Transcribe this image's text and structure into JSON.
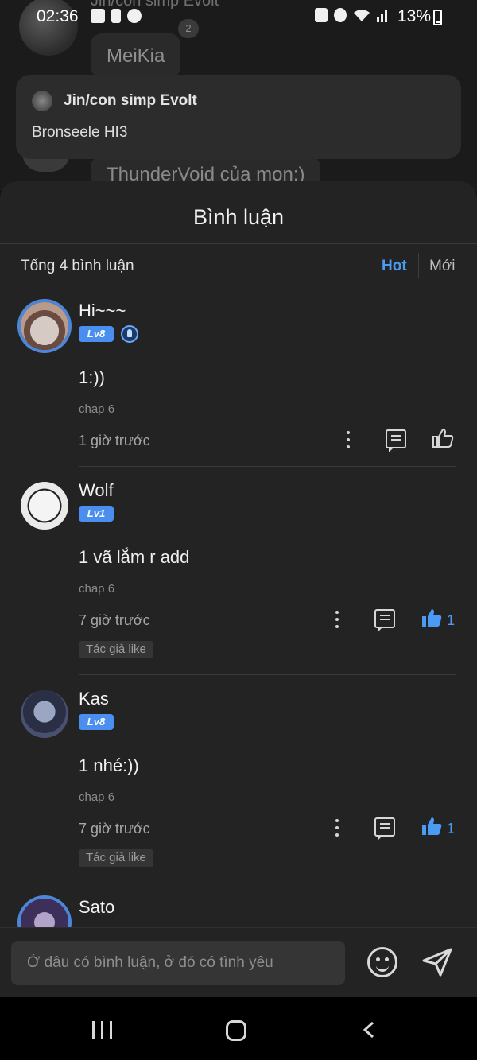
{
  "status_bar": {
    "time": "02:36",
    "battery": "13%"
  },
  "background_chat": {
    "sender_name": "Jin/con simp Evolt",
    "badge": "2",
    "message_1": "MeiKia",
    "message_2": "ThunderVoid của mọn:)"
  },
  "reply_card": {
    "name": "Jin/con simp Evolt",
    "text": "Bronseele HI3"
  },
  "sheet": {
    "title": "Bình luận",
    "total": "Tổng 4 bình luận",
    "sort_hot": "Hot",
    "sort_new": "Mới"
  },
  "comments": [
    {
      "name": "Hi~~~",
      "level": "Lv8",
      "text": "1:))",
      "chap": "chap 6",
      "time": "1 giờ trước",
      "likes": "",
      "author_like": ""
    },
    {
      "name": "Wolf",
      "level": "Lv1",
      "text": "1 vã lắm r add",
      "chap": "chap 6",
      "time": "7 giờ trước",
      "likes": "1",
      "author_like": "Tác giả like"
    },
    {
      "name": "Kas",
      "level": "Lv8",
      "text": "1 nhé:))",
      "chap": "chap 6",
      "time": "7 giờ trước",
      "likes": "1",
      "author_like": "Tác giả like"
    },
    {
      "name": "Sato",
      "level": "",
      "text": "",
      "chap": "",
      "time": "",
      "likes": "",
      "author_like": ""
    }
  ],
  "input": {
    "placeholder": "Ở đâu có bình luận, ở đó có tình yêu"
  },
  "colors": {
    "accent": "#4a9bf5",
    "sheet_bg": "#232323"
  }
}
